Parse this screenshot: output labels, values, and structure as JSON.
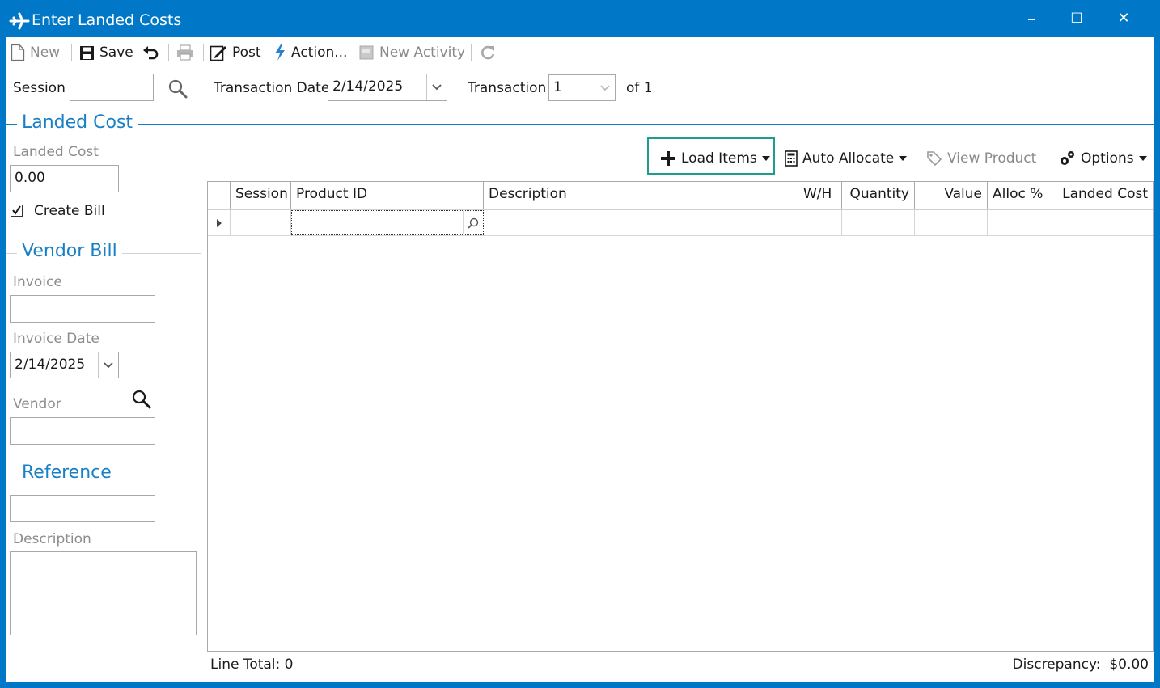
{
  "window": {
    "title": "Enter Landed Costs",
    "controls": {
      "minimize": "–",
      "maximize": "☐",
      "close": "✕"
    }
  },
  "toolbar": {
    "new_label": "New",
    "save_label": "Save",
    "post_label": "Post",
    "action_label": "Action...",
    "new_activity_label": "New Activity"
  },
  "header": {
    "session_label": "Session",
    "session_value": "",
    "transaction_date_label": "Transaction Date",
    "transaction_date_value": "2/14/2025",
    "transaction_label": "Transaction",
    "transaction_value": "1",
    "of_label": "of 1"
  },
  "landed_cost_section": {
    "title": "Landed Cost",
    "landed_cost_label": "Landed Cost",
    "landed_cost_value": "0.00",
    "create_bill_label": "Create Bill",
    "create_bill_checked": true
  },
  "vendor_bill_section": {
    "title": "Vendor Bill",
    "invoice_label": "Invoice",
    "invoice_value": "",
    "invoice_date_label": "Invoice Date",
    "invoice_date_value": "2/14/2025",
    "vendor_label": "Vendor",
    "vendor_value": ""
  },
  "reference_section": {
    "title": "Reference",
    "reference_value": "",
    "description_label": "Description",
    "description_value": ""
  },
  "grid_toolbar": {
    "load_items_label": "Load Items",
    "auto_allocate_label": "Auto Allocate",
    "view_product_label": "View Product",
    "options_label": "Options"
  },
  "grid": {
    "columns": [
      "Session",
      "Product ID",
      "Description",
      "W/H",
      "Quantity",
      "Value",
      "Alloc %",
      "Landed Cost"
    ]
  },
  "footer": {
    "line_total": "Line Total: 0",
    "discrepancy": "Discrepancy:  $0.00"
  },
  "colors": {
    "window_frame": "#0078c7",
    "section_title": "#1a80c6",
    "highlight": "#1f9d8a"
  }
}
